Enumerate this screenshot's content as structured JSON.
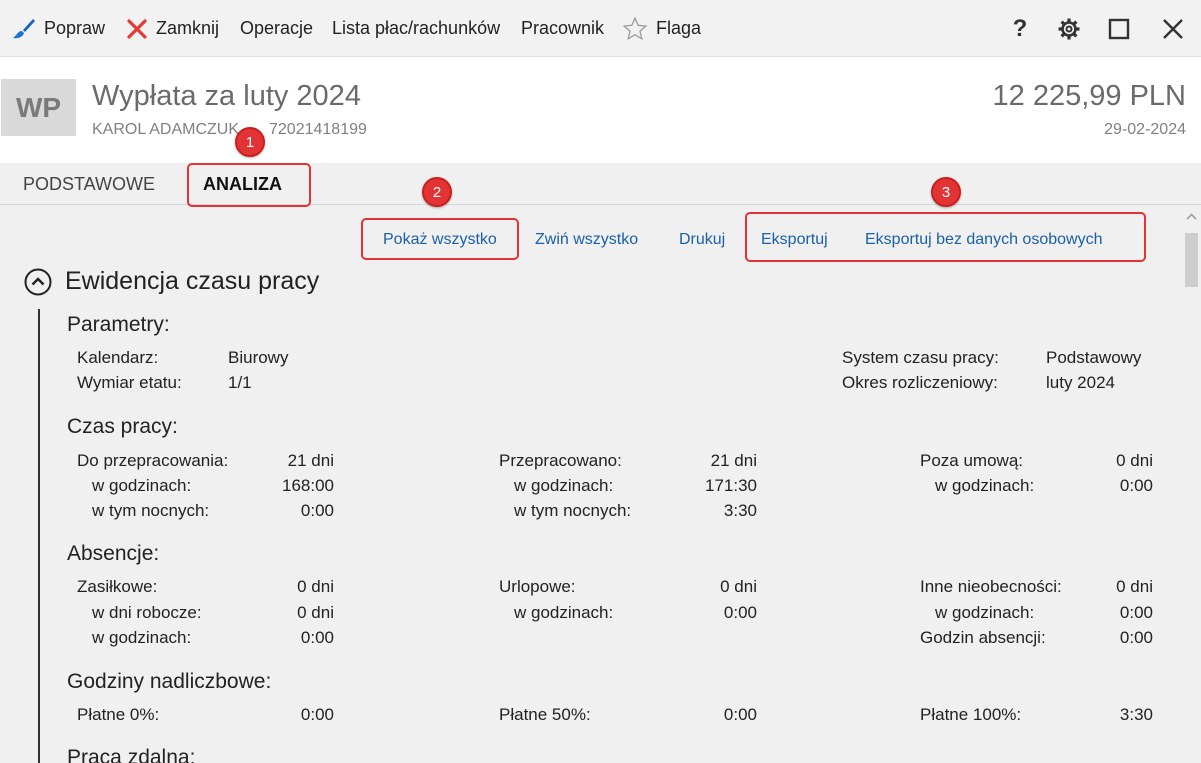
{
  "toolbar": {
    "popraw": "Popraw",
    "zamknij": "Zamknij",
    "operacje": "Operacje",
    "lista": "Lista płac/rachunków",
    "pracownik": "Pracownik",
    "flaga": "Flaga",
    "help": "?"
  },
  "header": {
    "badge": "WP",
    "title": "Wypłata za luty 2024",
    "employee": "KAROL ADAMCZUK",
    "pesel": "72021418199",
    "amount": "12 225,99 PLN",
    "date": "29-02-2024"
  },
  "tabs": {
    "podstawowe": "PODSTAWOWE",
    "analiza": "ANALIZA"
  },
  "actions": {
    "pokaz": "Pokaż wszystko",
    "zwin": "Zwiń wszystko",
    "drukuj": "Drukuj",
    "eksportuj": "Eksportuj",
    "eksportuj_bez": "Eksportuj bez danych osobowych"
  },
  "annotations": {
    "one": "1",
    "two": "2",
    "three": "3",
    "color": "#e23434"
  },
  "section": {
    "title": "Ewidencja czasu pracy",
    "parametry": {
      "heading": "Parametry:",
      "kalendarz_label": "Kalendarz:",
      "kalendarz_value": "Biurowy",
      "wymiar_label": "Wymiar etatu:",
      "wymiar_value": "1/1",
      "system_label": "System czasu pracy:",
      "system_value": "Podstawowy",
      "okres_label": "Okres rozliczeniowy:",
      "okres_value": "luty 2024"
    },
    "czas": {
      "heading": "Czas pracy:",
      "do_label": "Do przepracowania:",
      "do_value": "21 dni",
      "do_godz_label": "w godzinach:",
      "do_godz_value": "168:00",
      "do_noc_label": "w tym nocnych:",
      "do_noc_value": "0:00",
      "prze_label": "Przepracowano:",
      "prze_value": "21 dni",
      "prze_godz_label": "w godzinach:",
      "prze_godz_value": "171:30",
      "prze_noc_label": "w tym nocnych:",
      "prze_noc_value": "3:30",
      "poza_label": "Poza umową:",
      "poza_value": "0 dni",
      "poza_godz_label": "w godzinach:",
      "poza_godz_value": "0:00"
    },
    "absencje": {
      "heading": "Absencje:",
      "zas_label": "Zasiłkowe:",
      "zas_value": "0 dni",
      "zas_rob_label": "w dni robocze:",
      "zas_rob_value": "0 dni",
      "zas_godz_label": "w godzinach:",
      "zas_godz_value": "0:00",
      "url_label": "Urlopowe:",
      "url_value": "0 dni",
      "url_godz_label": "w godzinach:",
      "url_godz_value": "0:00",
      "inne_label": "Inne nieobecności:",
      "inne_value": "0 dni",
      "inne_godz_label": "w godzinach:",
      "inne_godz_value": "0:00",
      "godz_abs_label": "Godzin absencji:",
      "godz_abs_value": "0:00"
    },
    "nadliczbowe": {
      "heading": "Godziny nadliczbowe:",
      "p0_label": "Płatne 0%:",
      "p0_value": "0:00",
      "p50_label": "Płatne 50%:",
      "p50_value": "0:00",
      "p100_label": "Płatne 100%:",
      "p100_value": "3:30"
    },
    "zdalna": {
      "heading": "Praca zdalna:"
    }
  }
}
